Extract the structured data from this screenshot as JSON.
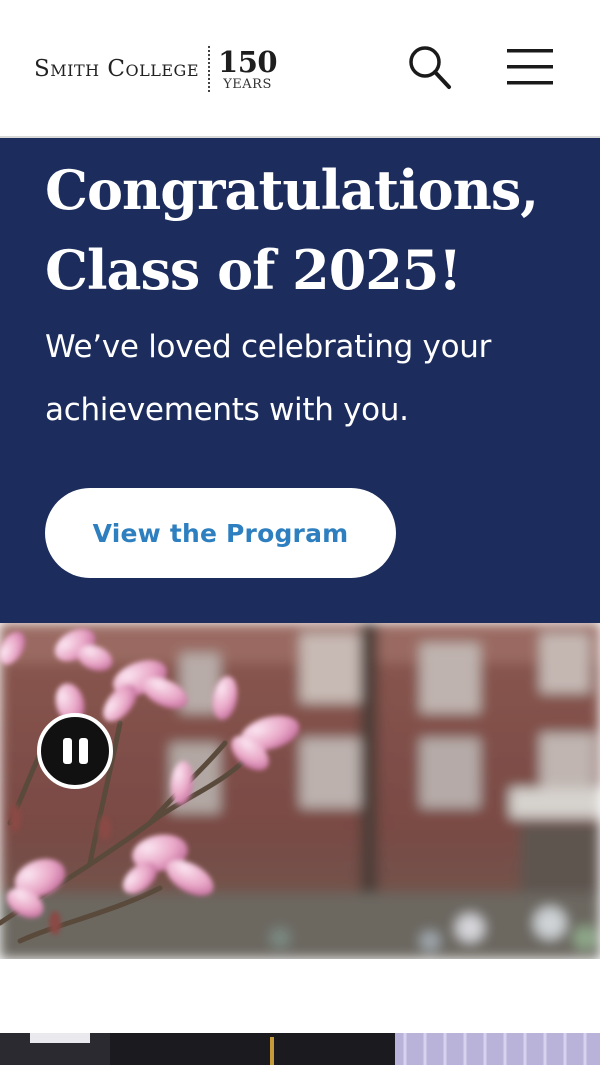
{
  "header": {
    "logo_name": "Smith College",
    "logo_number": "150",
    "logo_years": "YEARS"
  },
  "icons": {
    "search": "search-icon",
    "menu": "hamburger-menu-icon",
    "pause": "pause-icon"
  },
  "hero": {
    "title_line1": "Congratulations,",
    "title_line2": "Class of 2025!",
    "subtitle": "We’ve loved celebrating your achievements with you.",
    "cta_label": "View the Program"
  },
  "colors": {
    "hero_bg": "#1c2c5c",
    "cta_text": "#2d7fbf",
    "header_bg": "#ffffff"
  }
}
